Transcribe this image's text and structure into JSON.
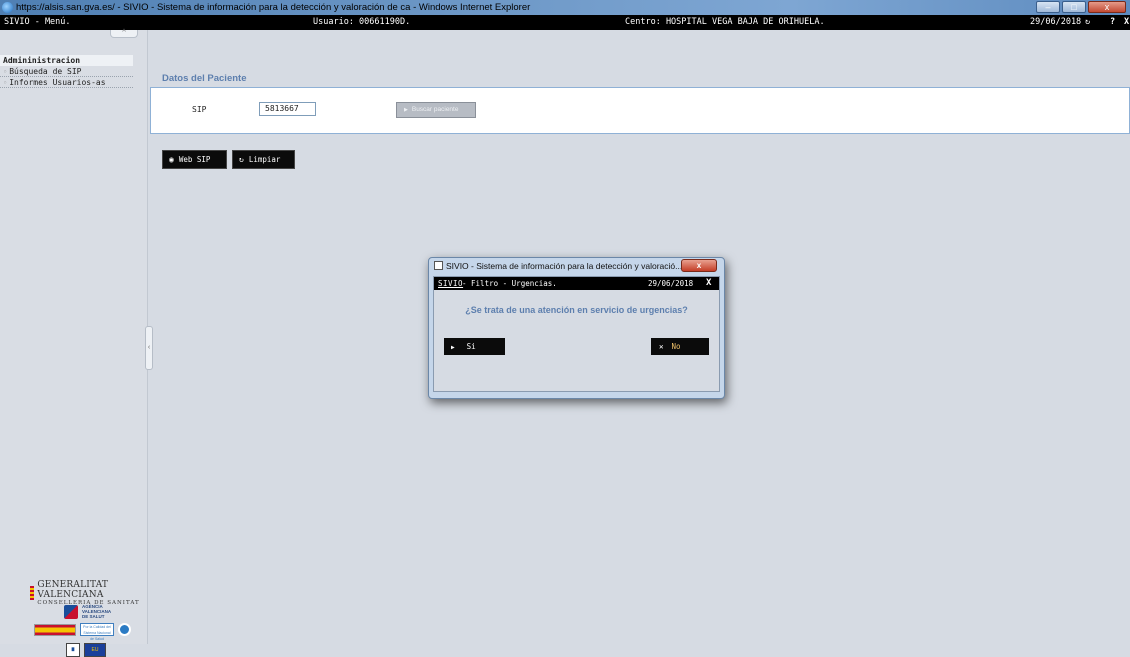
{
  "window": {
    "title": "https://alsis.san.gva.es/ - SIVIO - Sistema de información para la detección y valoración de ca - Windows Internet Explorer",
    "minimize": "–",
    "maximize": "□",
    "close": "x"
  },
  "appbar": {
    "menu": "SIVIO - Menú.",
    "user": "Usuario: 00661190D.",
    "center": "Centro: HOSPITAL VEGA BAJA DE ORIHUELA.",
    "date": "29/06/2018",
    "refresh_icon": "↻",
    "help": "?",
    "close": "X"
  },
  "sidebar": {
    "collapse": "^",
    "header": "Admininistracion",
    "items": [
      {
        "label": "Búsqueda de SIP"
      },
      {
        "label": "Informes Usuarios-as"
      }
    ],
    "handle": "‹",
    "logos": {
      "gva_line1": "GENERALITAT VALENCIANA",
      "gva_line2": "CONSELLERIA DE SANITAT",
      "agencia": "AGÈNCIA VALENCIANA DE SALUT",
      "calidad": "Por la Calidad del Sistema Nacional de Salud",
      "eu": "EU"
    }
  },
  "main": {
    "section_title": "Datos del Paciente",
    "sip_label": "SIP",
    "sip_value": "5813667",
    "search_button": "Buscar paciente",
    "websip_button": "Web SIP",
    "clear_button": "Limpiar"
  },
  "modal": {
    "window_title": "SIVIO - Sistema de información para la detección y valoració...",
    "close": "x",
    "brand": "SIVIO",
    "subtitle": "- Filtro - Urgencias.",
    "date": "29/06/2018",
    "bar_close": "X",
    "question": "¿Se trata de una atención en servicio de urgencias?",
    "yes": "Si",
    "no": "No"
  }
}
